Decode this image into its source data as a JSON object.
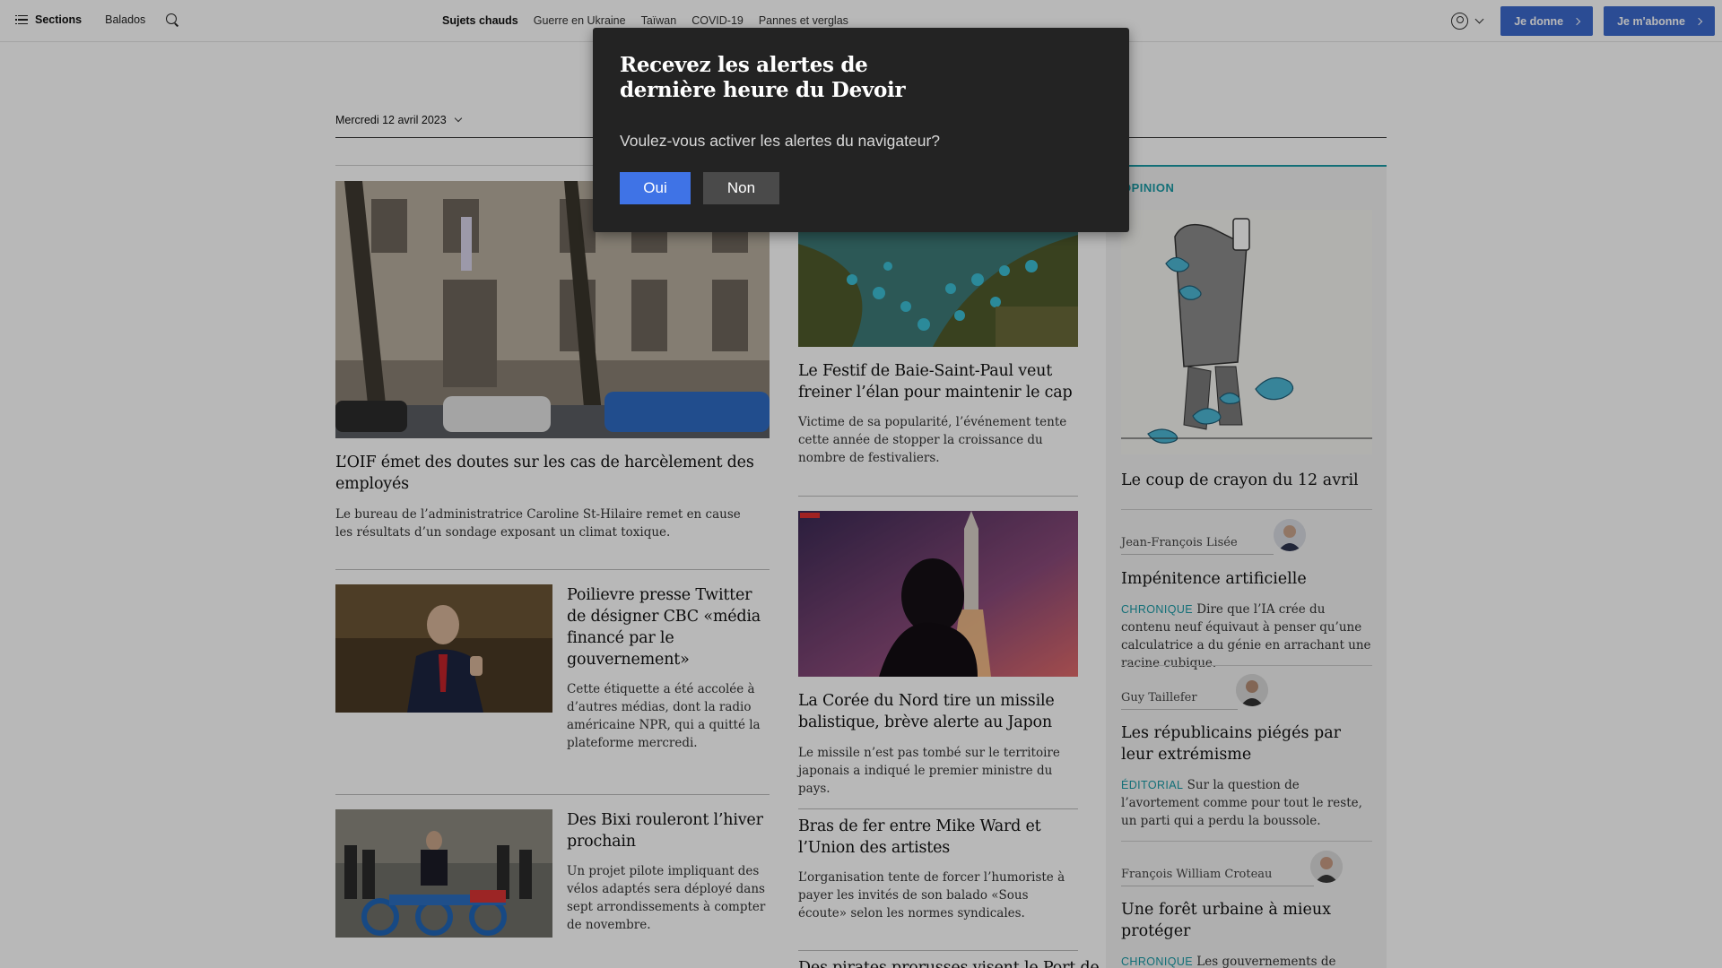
{
  "topbar": {
    "sections_label": "Sections",
    "balados_label": "Balados",
    "nav": [
      "Sujets chauds",
      "Guerre en Ukraine",
      "Taïwan",
      "COVID-19",
      "Pannes et verglas"
    ],
    "donate_label": "Je donne",
    "subscribe_label": "Je m'abonne",
    "accent_color": "#3c6acd"
  },
  "date": "Mercredi 12 avril 2023",
  "articles": [
    {
      "title": "L’OIF émet des doutes sur les cas de harcèlement des employés",
      "dek": "Le bureau de l’administratrice Caroline St-Hilaire remet en cause les résultats d’un sondage exposant un climat toxique."
    },
    {
      "title": "Poilievre presse Twitter de désigner CBC «média financé par le gouvernement»",
      "dek": "Cette étiquette a été accolée à d’autres médias, dont la radio américaine NPR, qui a quitté la plateforme mercredi."
    },
    {
      "title": "Des Bixi rouleront l’hiver prochain",
      "dek": "Un projet pilote impliquant des vélos adaptés sera déployé dans sept arrondissements à compter de novembre."
    },
    {
      "title": "Le Festif de Baie-Saint-Paul veut freiner l’élan pour maintenir le cap",
      "dek": "Victime de sa popularité, l’événement tente cette année de stopper la croissance du nombre de festivaliers."
    },
    {
      "title": "La Corée du Nord tire un missile balistique, brève alerte au Japon",
      "dek": "Le missile n’est pas tombé sur le territoire japonais a indiqué le premier ministre du pays."
    },
    {
      "title": "Bras de fer entre Mike Ward et l’Union des artistes",
      "dek": "L’organisation tente de forcer l’humoriste à payer les invités de son balado «Sous écoute» selon les normes syndicales."
    },
    {
      "title": "Des pirates prorusses visent le Port de"
    }
  ],
  "opinion": {
    "label": "OPINION",
    "cartoon_title": "Le coup de crayon du 12 avril",
    "items": [
      {
        "author": "Jean-François Lisée",
        "title": "Impénitence artificielle",
        "kicker": "CHRONIQUE",
        "dek": "Dire que l’IA crée du contenu neuf équivaut à penser qu’une calculatrice a du génie en arrachant une racine cubique."
      },
      {
        "author": "Guy Taillefer",
        "title": "Les républicains piégés par leur extrémisme",
        "kicker": "ÉDITORIAL",
        "dek": "Sur la question de l’avortement comme pour tout le reste, un parti qui a perdu la boussole."
      },
      {
        "author": "François William Croteau",
        "title": "Une forêt urbaine à mieux protéger",
        "kicker": "CHRONIQUE",
        "dek": "Les gouvernements de"
      }
    ]
  },
  "modal": {
    "title": "Recevez les alertes de dernière heure du Devoir",
    "question": "Voulez-vous activer les alertes du navigateur?",
    "yes_label": "Oui",
    "no_label": "Non"
  }
}
